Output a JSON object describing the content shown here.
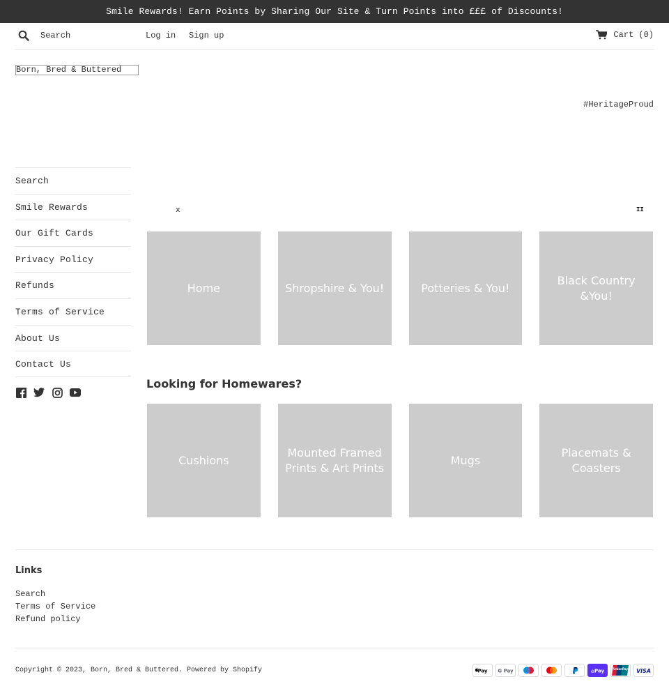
{
  "announcement": "Smile Rewards! Earn Points by Sharing Our Site & Turn Points into £££ of Discounts!",
  "header": {
    "search_placeholder": "Search",
    "login": "Log in",
    "signup": "Sign up",
    "cart": "Cart (0)"
  },
  "logo_text": "Born, Bred & Buttered",
  "tagline": "#HeritageProud",
  "sidebar": {
    "items": [
      {
        "label": "Search"
      },
      {
        "label": "Smile Rewards"
      },
      {
        "label": "Our Gift Cards"
      },
      {
        "label": "Privacy Policy"
      },
      {
        "label": "Refunds"
      },
      {
        "label": "Terms of Service"
      },
      {
        "label": "About Us"
      },
      {
        "label": "Contact Us"
      }
    ],
    "social": [
      "facebook-icon",
      "twitter-icon",
      "instagram-icon",
      "youtube-icon"
    ]
  },
  "slideshow": {
    "close_glyph": "x",
    "pause_glyph": "II"
  },
  "collections": [
    {
      "title": "Home"
    },
    {
      "title": "Shropshire & You!"
    },
    {
      "title": "Potteries & You!"
    },
    {
      "title": "Black Country &You!"
    }
  ],
  "homewares": {
    "heading": "Looking for Homewares?",
    "items": [
      {
        "title": "Cushions"
      },
      {
        "title": "Mounted Framed Prints & Art Prints"
      },
      {
        "title": "Mugs"
      },
      {
        "title": "Placemats & Coasters"
      }
    ]
  },
  "footer": {
    "heading": "Links",
    "links": [
      {
        "label": "Search"
      },
      {
        "label": "Terms of Service"
      },
      {
        "label": "Refund policy"
      }
    ],
    "copyright": "Copyright © 2023, Born, Bred & Buttered. Powered by Shopify",
    "payments": [
      "Apple Pay",
      "G Pay",
      "Maestro",
      "Mastercard",
      "PayPal",
      "Shop Pay",
      "Union Pay",
      "VISA"
    ]
  },
  "colors": {
    "announcement_bg": "#333333",
    "tile_bg": "#cccccc",
    "text": "#333333"
  }
}
